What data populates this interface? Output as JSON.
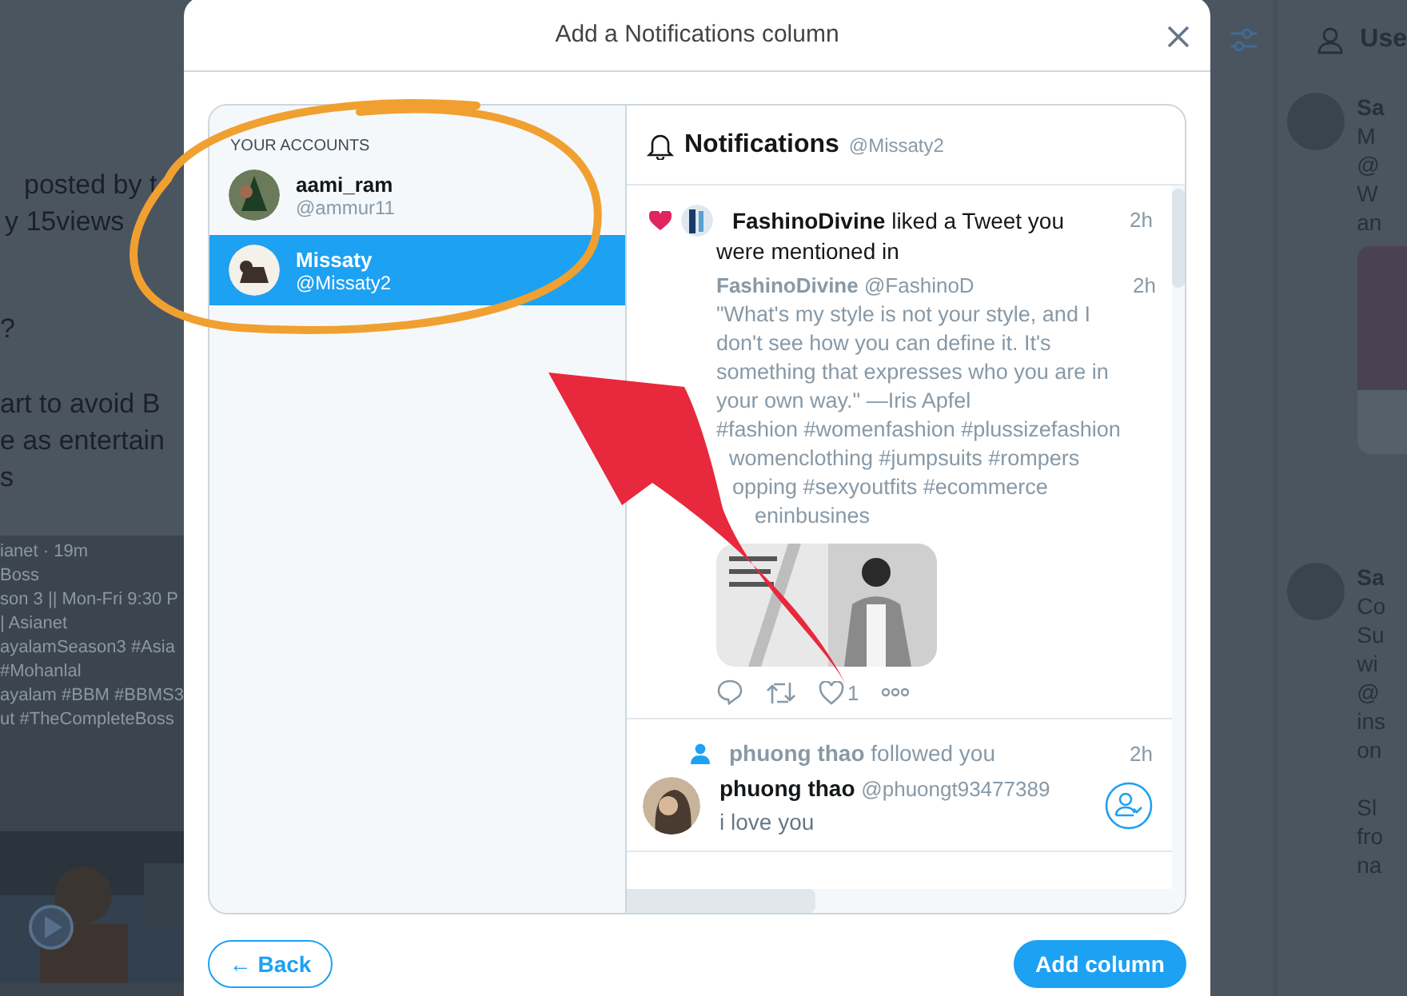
{
  "background": {
    "left_lines": [
      "posted by t",
      "y 15views",
      "?",
      "art to avoid B",
      "e as entertain",
      "s"
    ],
    "left_tweet_lines": [
      "ianet · 19m",
      "Boss",
      "son 3 || Mon-Fri 9:30 P",
      "| Asianet",
      "ayalamSeason3 #Asia",
      "#Mohanlal",
      "ayalam #BBM #BBMS3",
      "ut #TheCompleteBoss"
    ],
    "right_header": "Use",
    "right_tweets": [
      {
        "lines": [
          "Sa",
          "M",
          "@",
          "W",
          "an"
        ]
      },
      {
        "lines": [
          "Sa",
          "Co",
          "Su",
          "wi",
          "@",
          "ins",
          "on"
        ],
        "more_lines": [
          "Sl",
          "fro",
          "na"
        ]
      }
    ]
  },
  "modal": {
    "title": "Add a Notifications column",
    "accounts_heading": "YOUR ACCOUNTS",
    "accounts": [
      {
        "name": "aami_ram",
        "handle": "@ammur11",
        "selected": false
      },
      {
        "name": "Missaty",
        "handle": "@Missaty2",
        "selected": true
      }
    ],
    "column": {
      "title": "Notifications",
      "handle": "@Missaty2",
      "items": [
        {
          "kind": "like",
          "text_lines": [
            "**FashinoDivine** liked a Tweet you",
            "were mentioned in"
          ],
          "time": "2h",
          "tweet": {
            "author": "FashinoDivine",
            "handle": "@FashinoD",
            "time": "2h",
            "text": "\"What's my style is not your style, and I don't see how you can define it. It's something that expresses who you are in your own way.\" —Iris Apfel",
            "tag_lines": [
              "#fashion #womenfashion #plussizefashion",
              "womenclothing #jumpsuits #rompers",
              "opping #sexyoutfits #ecommerce",
              "eninbusines"
            ],
            "likes": "1"
          }
        },
        {
          "kind": "follow",
          "actor": "phuong thao",
          "action": "followed you",
          "time": "2h",
          "user": {
            "name": "phuong thao",
            "handle": "@phuongt93477389",
            "bio": "i love you"
          }
        }
      ]
    },
    "back_button": "← Back",
    "add_button": "Add column"
  }
}
